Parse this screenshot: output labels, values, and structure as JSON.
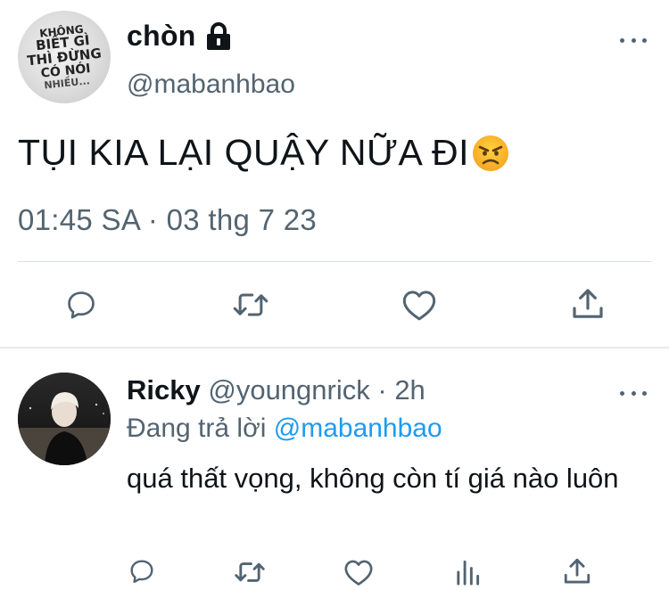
{
  "tweet": {
    "avatar_text": [
      "KHÔNG",
      "BIẾT GÌ",
      "THÌ ĐỪNG",
      "CÓ NÓI",
      "NHIỀU..."
    ],
    "display_name": "chòn",
    "handle": "@mabanhbao",
    "text": "TỤI KIA LẠI QUẬY NỮA ĐI",
    "timestamp": "01:45 SA · 03 thg 7 23",
    "actions": [
      "reply-icon",
      "retweet-icon",
      "like-icon",
      "share-icon"
    ]
  },
  "reply": {
    "display_name": "Ricky",
    "handle": "@youngnrick",
    "separator": " · ",
    "time": "2h",
    "replying_label": "Đang trả lời ",
    "replying_to": "@mabanhbao",
    "text": "quá thất vọng, không còn tí giá nào luôn",
    "actions": [
      "reply-icon",
      "retweet-icon",
      "like-icon",
      "views-icon",
      "share-icon"
    ]
  },
  "colors": {
    "text": "#0f1419",
    "secondary": "#536471",
    "link": "#1d9bf0",
    "divider": "#dcdfe2"
  }
}
